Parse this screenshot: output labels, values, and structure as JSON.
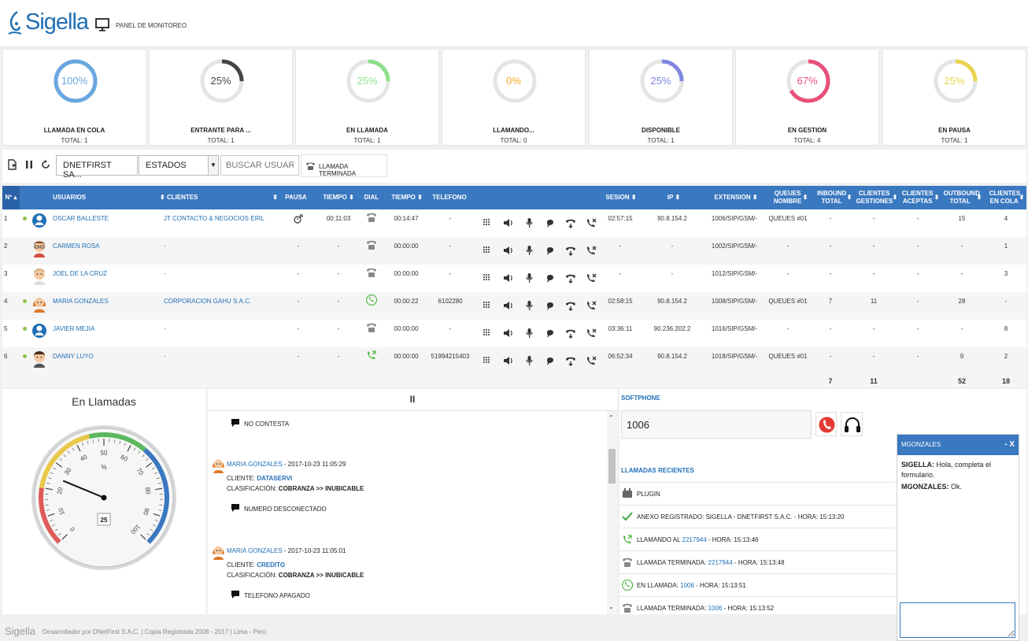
{
  "header": {
    "logo_text": "Sigella",
    "panel_title": "PANEL DE MONITOREO"
  },
  "stats": [
    {
      "pct": "100%",
      "value": 1.0,
      "label": "LLAMADA EN COLA",
      "total": "TOTAL: 1",
      "color": "#6aa7e0"
    },
    {
      "pct": "25%",
      "value": 0.25,
      "label": "ENTRANTE PARA ...",
      "total": "TOTAL: 1",
      "color": "#444444"
    },
    {
      "pct": "25%",
      "value": 0.25,
      "label": "EN LLAMADA",
      "total": "TOTAL: 1",
      "color": "#8de08a"
    },
    {
      "pct": "0%",
      "value": 0.0,
      "label": "LLAMANDO...",
      "total": "TOTAL: 0",
      "color": "#f5a623"
    },
    {
      "pct": "25%",
      "value": 0.25,
      "label": "DISPONIBLE",
      "total": "TOTAL: 1",
      "color": "#7f86e0"
    },
    {
      "pct": "67%",
      "value": 0.67,
      "label": "EN GESTION",
      "total": "TOTAL: 4",
      "color": "#e8507a"
    },
    {
      "pct": "25%",
      "value": 0.25,
      "label": "EN PAUSA",
      "total": "TOTAL: 1",
      "color": "#e8d44d"
    }
  ],
  "toolbar": {
    "company_select": "DNETFIRST SA...",
    "status_select": "ESTADOS",
    "search_placeholder": "BUSCAR USUARIO",
    "ended_button": "LLAMADA TERMINADA"
  },
  "table": {
    "headers": {
      "num": "Nº",
      "users": "USUARIOS",
      "clients": "CLIENTES",
      "pause": "PAUSA",
      "time1": "TIEMPO",
      "dial": "DIAL",
      "time2": "TIEMPO",
      "phone": "TELEFONO",
      "session": "SESION",
      "ip": "IP",
      "extension": "EXTENSION",
      "queues": "QUEUES NOMBRE",
      "inbound": "INBOUND TOTAL",
      "clients_mgmt": "CLIENTES GESTIONES",
      "clients_acc": "CLIENTES ACEPTAS",
      "outbound": "OUTBOUND TOTAL",
      "clients_queue": "CLIENTES EN COLA"
    },
    "rows": [
      {
        "num": "1",
        "online": true,
        "avatar": "blue",
        "user": "OSCAR BALLESTE",
        "client": "JT CONTACTO & NEGOCIOS EIRL",
        "pause": "icon",
        "time1": "00:11:03",
        "dial": "grey",
        "time2": "00:14:47",
        "phone": "-",
        "session": "02:57:15",
        "ip": "90.8.154.2",
        "ext": "1006/SIP/GSM/-",
        "queue": "QUEUES #01",
        "inbound": "-",
        "cg": "-",
        "ca": "-",
        "outbound": "15",
        "cq": "4"
      },
      {
        "num": "2",
        "online": false,
        "avatar": "glasses",
        "user": "CARMEN ROSA",
        "client": "-",
        "pause": "-",
        "time1": "-",
        "dial": "grey",
        "time2": "00:00:00",
        "phone": "-",
        "session": "-",
        "ip": "-",
        "ext": "1002/SIP/GSM/-",
        "queue": "-",
        "inbound": "-",
        "cg": "-",
        "ca": "-",
        "outbound": "-",
        "cq": "1"
      },
      {
        "num": "3",
        "online": false,
        "avatar": "bald",
        "user": "JOEL DE LA CRUZ",
        "client": "-",
        "pause": "-",
        "time1": "-",
        "dial": "grey",
        "time2": "00:00:00",
        "phone": "-",
        "session": "-",
        "ip": "-",
        "ext": "1012/SIP/GSM/-",
        "queue": "-",
        "inbound": "-",
        "cg": "-",
        "ca": "-",
        "outbound": "-",
        "cq": "3"
      },
      {
        "num": "4",
        "online": true,
        "avatar": "woman",
        "user": "MARIA GONZALES",
        "client": "CORPORACION GAHU S.A.C.",
        "pause": "-",
        "time1": "-",
        "dial": "green",
        "time2": "00:00:22",
        "phone": "6102280",
        "session": "02:58:15",
        "ip": "90.8.154.2",
        "ext": "1008/SIP/GSM/-",
        "queue": "QUEUES #01",
        "inbound": "7",
        "cg": "11",
        "ca": "-",
        "outbound": "28",
        "cq": "-"
      },
      {
        "num": "5",
        "online": true,
        "avatar": "blue",
        "user": "JAVIER MEJIA",
        "client": "-",
        "pause": "-",
        "time1": "-",
        "dial": "grey",
        "time2": "00:00:00",
        "phone": "-",
        "session": "03:36:11",
        "ip": "90.236.202.2",
        "ext": "1016/SIP/GSM/-",
        "queue": "-",
        "inbound": "-",
        "cg": "-",
        "ca": "-",
        "outbound": "-",
        "cq": "8"
      },
      {
        "num": "6",
        "online": true,
        "avatar": "man",
        "user": "DANNY LUYO",
        "client": "-",
        "pause": "-",
        "time1": "-",
        "dial": "calling",
        "time2": "00:00:00",
        "phone": "51994215403",
        "session": "06:52:34",
        "ip": "90.8.154.2",
        "ext": "1018/SIP/GSM/-",
        "queue": "QUEUES #01",
        "inbound": "-",
        "cg": "-",
        "ca": "-",
        "outbound": "9",
        "cq": "2"
      }
    ],
    "totals": {
      "inbound": "7",
      "cg": "11",
      "outbound": "52",
      "cq": "18"
    }
  },
  "gauge": {
    "title": "En Llamadas",
    "value": 25,
    "value_label": "25",
    "unit": "%",
    "ticks": [
      "0",
      "10",
      "20",
      "30",
      "40",
      "50",
      "60",
      "70",
      "80",
      "90",
      "100"
    ]
  },
  "feed": {
    "pause_icon": "II",
    "items": [
      {
        "type": "note",
        "text": "NO CONTESTA"
      },
      {
        "type": "entry",
        "name": "MARIA GONZALES",
        "date": " - 2017-10-23 11:05:29",
        "client_label": "CLIENTE: ",
        "client": "DATASERVI",
        "class_label": "CLASIFICACIÓN: ",
        "class": "COBRANZA >> INUBICABLE",
        "note": "NUMERO DESCONECTADO"
      },
      {
        "type": "entry",
        "name": "MARIA GONZALES",
        "date": " - 2017-10-23 11:05:01",
        "client_label": "CLIENTE: ",
        "client": "CREDITO",
        "class_label": "CLASIFICACIÓN: ",
        "class": "COBRANZA >> INUBICABLE",
        "note": "TELEFONO APAGADO"
      }
    ]
  },
  "softphone": {
    "title": "SOFTPHONE",
    "extension": "1006",
    "recent_title": "LLAMADAS RECIENTES",
    "recent": [
      {
        "icon": "plugin",
        "pre": "PLUGIN",
        "num": "",
        "post": ""
      },
      {
        "icon": "check",
        "pre": "ANEXO REGISTRADO: SIGELLA - DNETFIRST S.A.C. - HORA: 15:13:20",
        "num": "",
        "post": ""
      },
      {
        "icon": "calling",
        "pre": "LLAMANDO AL ",
        "num": "2217944",
        "post": " - HORA: 15:13:46"
      },
      {
        "icon": "phone",
        "pre": "LLAMADA TERMINADA: ",
        "num": "2217944",
        "post": " - HORA: 15:13:48"
      },
      {
        "icon": "green",
        "pre": "EN LLAMADA: ",
        "num": "1006",
        "post": " - HORA: 15:13:51"
      },
      {
        "icon": "phone",
        "pre": "LLAMADA TERMINADA: ",
        "num": "1006",
        "post": " - HORA: 15:13:52"
      }
    ]
  },
  "chat": {
    "title": "MGONZALES",
    "close": "- X",
    "messages": [
      {
        "from": "SIGELLA:",
        "text": " Hola, completa el formulario."
      },
      {
        "from": "MGONZALES:",
        "text": " Ok."
      }
    ]
  },
  "footer": {
    "logo": "Sigella",
    "text": "Desarrollador por DNetFirst S.A.C. | Copia Registrada 2008 - 2017 | Lima - Perú"
  }
}
